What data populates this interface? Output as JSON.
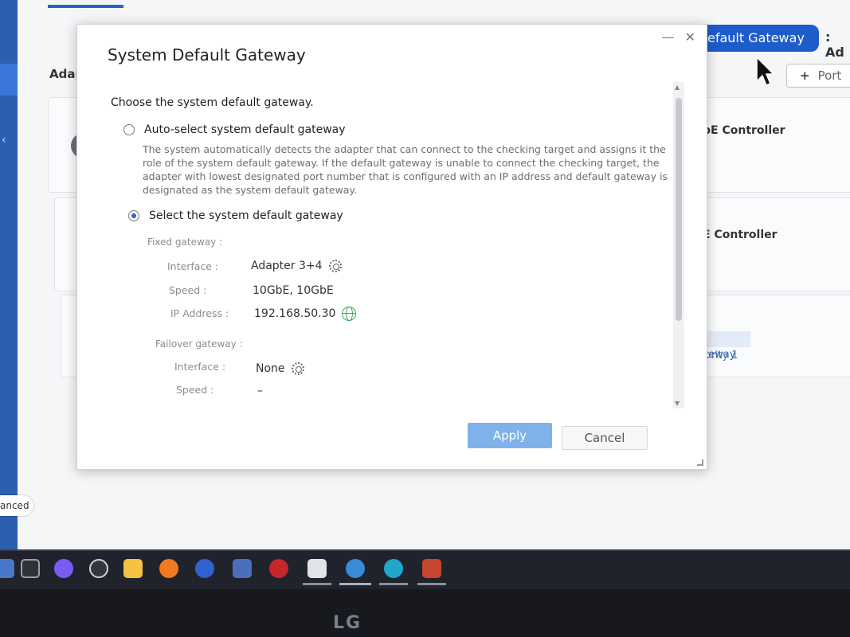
{
  "background": {
    "adapters_label": "Adap",
    "default_gateway_button": "efault Gateway",
    "header_extra": ": Ad",
    "port_button": "Port",
    "controller_1": "bE Controller",
    "controller_2": "bE Controller",
    "gateway_tag": "Gateway",
    "priority_tag": "Priority 1",
    "advanced_button": "anced",
    "card_icon_text": "E"
  },
  "dialog": {
    "title": "System Default Gateway",
    "controls": "— ✕",
    "intro": "Choose the system default gateway.",
    "auto_option": {
      "label": "Auto-select system default gateway",
      "selected": false,
      "description": "The system automatically detects the adapter that can connect to the checking target and assigns it the role of the system default gateway. If the default gateway is unable to connect the checking target, the adapter with lowest designated port number that is configured with an IP address and default gateway is designated as the system default gateway."
    },
    "manual_option": {
      "label": "Select the system default gateway",
      "selected": true
    },
    "fixed_gateway": {
      "section": "Fixed gateway :",
      "interface_label": "Interface :",
      "interface_value": "Adapter 3+4",
      "speed_label": "Speed :",
      "speed_value": "10GbE, 10GbE",
      "ip_label": "IP Address :",
      "ip_value": "192.168.50.30"
    },
    "failover_gateway": {
      "section": "Failover gateway :",
      "interface_label": "Interface :",
      "interface_value": "None",
      "speed_label": "Speed :",
      "speed_value": "–"
    },
    "apply_label": "Apply",
    "cancel_label": "Cancel"
  },
  "monitor": {
    "brand": "LG"
  },
  "colors": {
    "accent": "#1e5ccc",
    "apply_disabled": "#7fb2ea",
    "ip_globe": "#41a35a"
  }
}
